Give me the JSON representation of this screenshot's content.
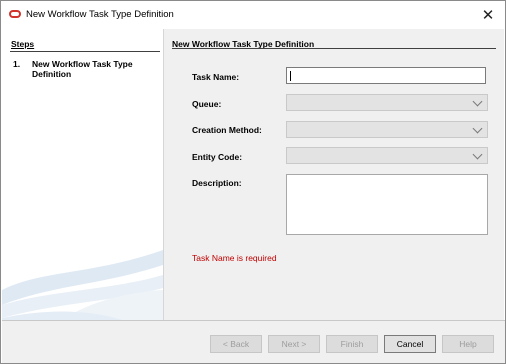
{
  "window": {
    "title": "New Workflow Task Type Definition",
    "close_glyph": "✕"
  },
  "steps": {
    "header": "Steps",
    "items": [
      {
        "number": "1.",
        "label": "New Workflow Task Type Definition"
      }
    ]
  },
  "page": {
    "header": "New Workflow Task Type Definition",
    "fields": {
      "task_name": {
        "label": "Task Name:",
        "value": ""
      },
      "queue": {
        "label": "Queue:",
        "value": ""
      },
      "creation_method": {
        "label": "Creation Method:",
        "value": ""
      },
      "entity_code": {
        "label": "Entity Code:",
        "value": ""
      },
      "description": {
        "label": "Description:",
        "value": ""
      }
    },
    "error_message": "Task Name is required"
  },
  "buttons": {
    "back": "< Back",
    "next": "Next >",
    "finish": "Finish",
    "cancel": "Cancel",
    "help": "Help"
  },
  "colors": {
    "error": "#c00000",
    "brand_icon": "#d2332b"
  },
  "icons": {
    "app": "oracle-logo-icon",
    "close": "close-icon",
    "dropdown": "chevron-down-icon"
  }
}
